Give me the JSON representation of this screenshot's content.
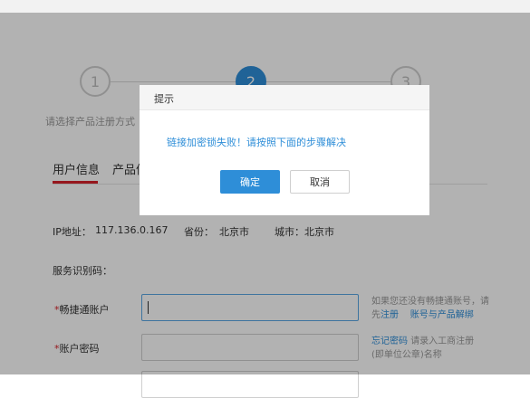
{
  "steps": [
    {
      "number": "1",
      "label": "请选择产品注册方式"
    },
    {
      "number": "2",
      "label": ""
    },
    {
      "number": "3",
      "label": ""
    }
  ],
  "tabs": [
    {
      "label": "用户信息"
    },
    {
      "label": "产品信"
    }
  ],
  "info": {
    "ip_label": "IP地址：",
    "ip_value": "117.136.0.167",
    "province_label": "省份：",
    "province_value": "北京市",
    "city_label": "城市：",
    "city_value": "北京市"
  },
  "service_code_label": "服务识别码：",
  "form": {
    "account": {
      "required_mark": "*",
      "label": "畅捷通账户",
      "value": "",
      "hint_prefix": "如果您还没有畅捷通账号，请先",
      "register_link": "注册",
      "unbind_link": "账号与产品解绑"
    },
    "password": {
      "required_mark": "*",
      "label": "账户密码",
      "value": "",
      "forgot_link": "忘记密码",
      "hint": "请录入工商注册(即单位公章)名称"
    }
  },
  "dialog": {
    "title": "提示",
    "message": "链接加密锁失败！请按照下面的步骤解决",
    "confirm_label": "确定",
    "cancel_label": "取消"
  },
  "colors": {
    "accent": "#2e8ed8",
    "tab_active_underline": "#d7222a",
    "required": "#d7222a"
  }
}
